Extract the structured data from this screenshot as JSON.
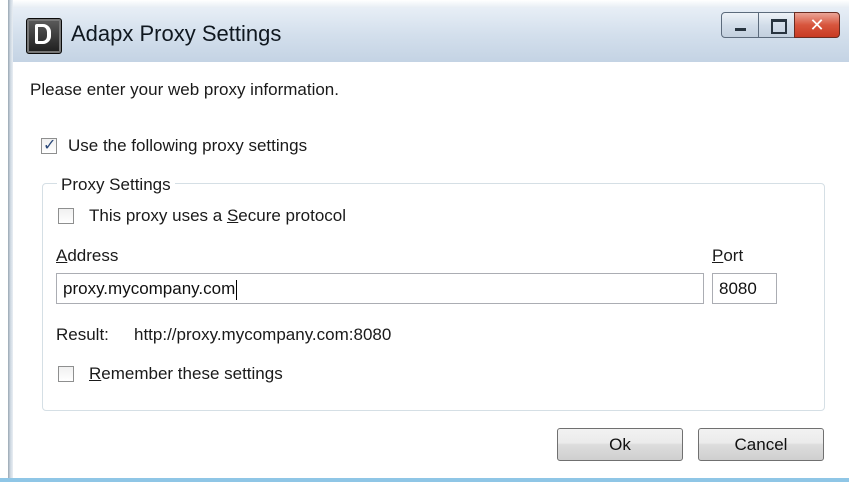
{
  "window": {
    "title": "Adapx Proxy Settings",
    "controls": {
      "close_glyph": "✕"
    }
  },
  "content": {
    "intro": "Please enter your web proxy information.",
    "use_proxy": {
      "label": "Use the following proxy settings",
      "checked": true
    },
    "group": {
      "title": "Proxy Settings",
      "secure": {
        "prefix": "This proxy uses a ",
        "accel": "S",
        "suffix": "ecure protocol",
        "checked": false
      },
      "address": {
        "accel": "A",
        "rest": "ddress",
        "value": "proxy.mycompany.com"
      },
      "port": {
        "accel": "P",
        "rest": "ort",
        "value": "8080"
      },
      "result": {
        "label": "Result:",
        "value": "http://proxy.mycompany.com:8080"
      },
      "remember": {
        "accel": "R",
        "rest": "emember these settings",
        "checked": false
      }
    }
  },
  "buttons": {
    "ok": "Ok",
    "cancel": "Cancel"
  },
  "colors": {
    "titlebar": "#d3dfec",
    "close_button": "#d7553d",
    "accent_line": "#8fc6e6"
  }
}
